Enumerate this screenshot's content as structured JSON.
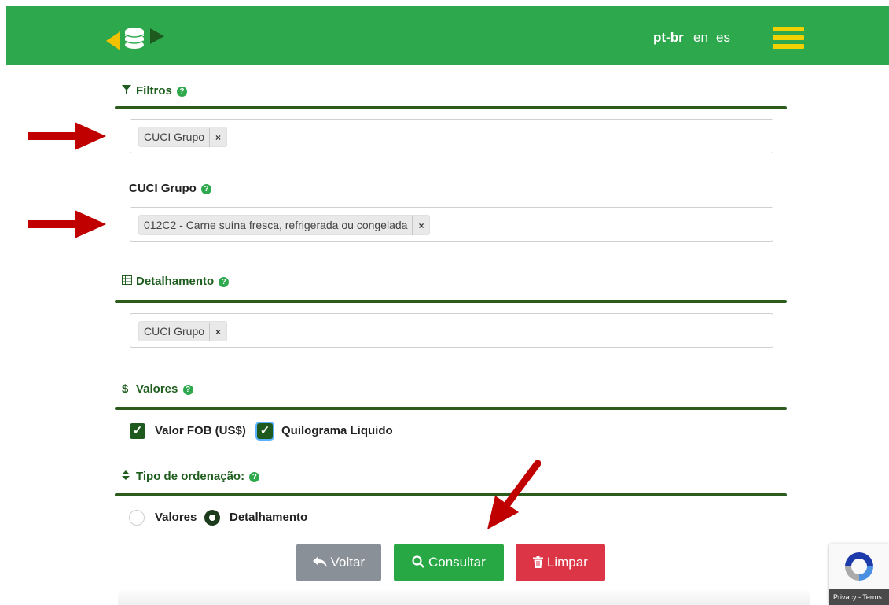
{
  "header": {
    "languages": [
      {
        "label": "pt-br",
        "active": true
      },
      {
        "label": "en",
        "active": false
      },
      {
        "label": "es",
        "active": false
      }
    ],
    "colors": {
      "bar": "#2ea84c",
      "menu": "#f2d100"
    }
  },
  "filters": {
    "title": "Filtros",
    "help": "?",
    "selected_tags": [
      "CUCI Grupo"
    ],
    "remove_glyph": "×"
  },
  "cuci_group": {
    "label": "CUCI Grupo",
    "help": "?",
    "selected_tags": [
      "012C2 - Carne suína fresca, refrigerada ou congelada"
    ],
    "remove_glyph": "×"
  },
  "detail": {
    "title": "Detalhamento",
    "help": "?",
    "selected_tags": [
      "CUCI Grupo"
    ],
    "remove_glyph": "×"
  },
  "values": {
    "title": "Valores",
    "help": "?",
    "checkboxes": [
      {
        "label": "Valor FOB (US$)",
        "checked": true
      },
      {
        "label": "Quilograma Liquido",
        "checked": true
      }
    ]
  },
  "ordering": {
    "title": "Tipo de ordenação:",
    "help": "?",
    "options": [
      {
        "label": "Valores",
        "selected": false
      },
      {
        "label": "Detalhamento",
        "selected": true
      }
    ]
  },
  "actions": {
    "back": "Voltar",
    "query": "Consultar",
    "clear": "Limpar"
  },
  "recaptcha": {
    "footer": "Privacy - Terms"
  },
  "annotation_colors": {
    "arrow": "#c00000"
  }
}
